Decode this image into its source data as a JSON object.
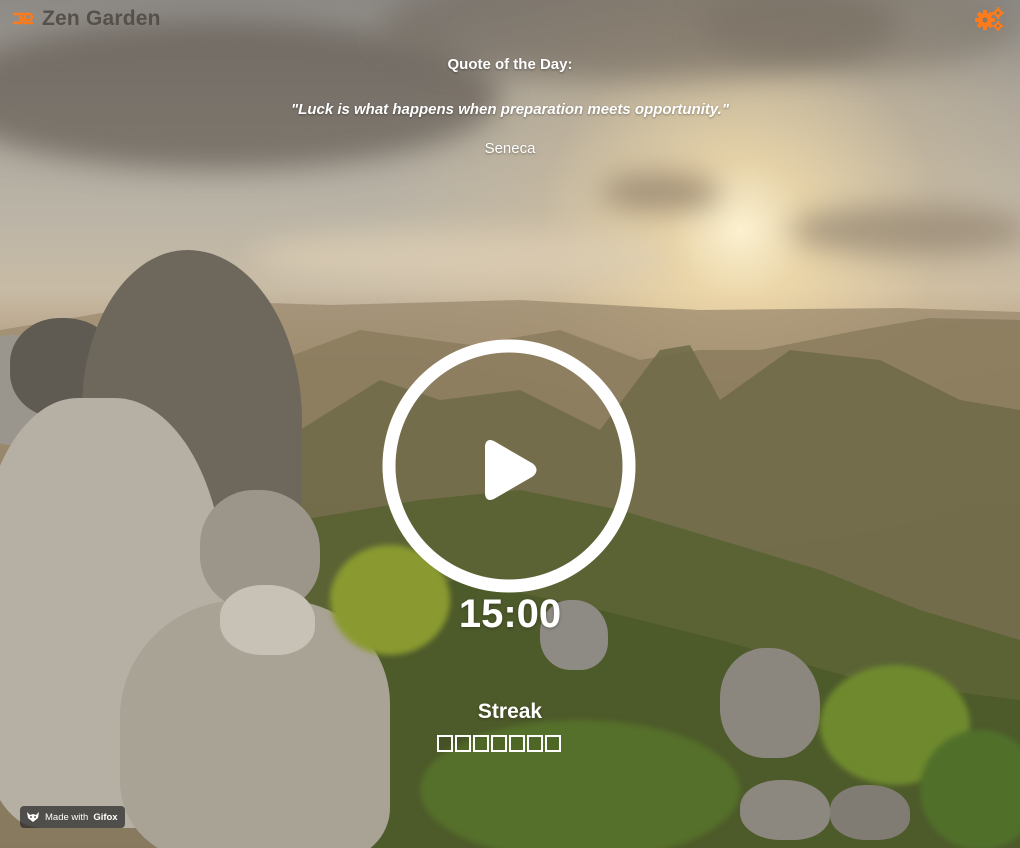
{
  "app": {
    "title": "Zen Garden",
    "accent_color": "#ff7a1a"
  },
  "header": {
    "logo_icon": "zen-logo-icon",
    "settings_icon": "gears-icon"
  },
  "quote": {
    "heading": "Quote of the Day:",
    "text": "\"Luck is what happens when preparation meets opportunity.\"",
    "author": "Seneca"
  },
  "player": {
    "play_icon": "play-icon",
    "timer": "15:00"
  },
  "streak": {
    "label": "Streak",
    "days": [
      false,
      false,
      false,
      false,
      false,
      false,
      false
    ]
  },
  "badge": {
    "prefix": "Made with",
    "brand": "Gifox",
    "icon": "fox-icon"
  }
}
